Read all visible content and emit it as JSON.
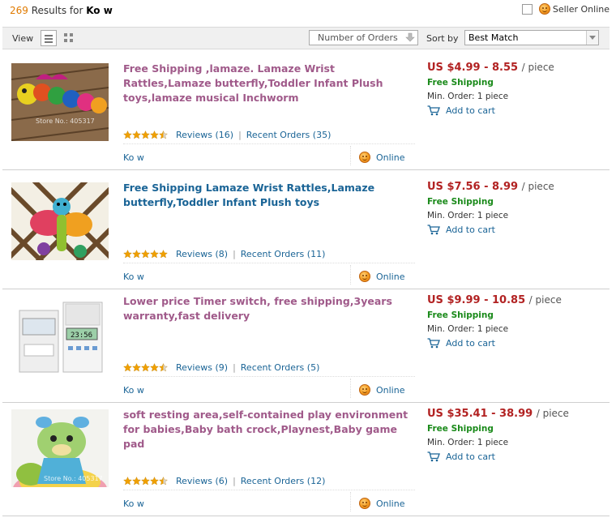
{
  "header": {
    "result_count": "269",
    "results_for": "Results for",
    "keyword": "Ko w",
    "seller_online_label": "Seller Online"
  },
  "toolbar": {
    "view_label": "View",
    "orders_sort_label": "Number of Orders",
    "sort_by_label": "Sort by",
    "sort_by_value": "Best Match"
  },
  "products": [
    {
      "title": "Free Shipping ,lamaze. Lamaze Wrist Rattles,Lamaze butterfly,Toddler Infant Plush toys,lamaze musical Inchworm",
      "rating": 4.5,
      "reviews": "Reviews (16)",
      "recent_orders": "Recent Orders (35)",
      "seller": "Ko w",
      "online": "Online",
      "price": "US $4.99 - 8.55",
      "unit": "/ piece",
      "shipping": "Free Shipping",
      "min_order": "Min. Order: 1 piece",
      "add_to_cart": "Add to cart",
      "image_watermark": "Store No.: 405317"
    },
    {
      "title": "Free Shipping Lamaze Wrist Rattles,Lamaze butterfly,Toddler Infant Plush toys",
      "rating": 5,
      "reviews": "Reviews (8)",
      "recent_orders": "Recent Orders (11)",
      "seller": "Ko w",
      "online": "Online",
      "price": "US $7.56 - 8.99",
      "unit": "/ piece",
      "shipping": "Free Shipping",
      "min_order": "Min. Order: 1 piece",
      "add_to_cart": "Add to cart",
      "image_watermark": ""
    },
    {
      "title": "Lower price Timer switch, free shipping,3years warranty,fast delivery",
      "rating": 4.5,
      "reviews": "Reviews (9)",
      "recent_orders": "Recent Orders (5)",
      "seller": "Ko w",
      "online": "Online",
      "price": "US $9.99 - 10.85",
      "unit": "/ piece",
      "shipping": "Free Shipping",
      "min_order": "Min. Order: 1 piece",
      "add_to_cart": "Add to cart",
      "image_watermark": ""
    },
    {
      "title": "soft resting area,self-contained play environment for babies,Baby bath crock,Playnest,Baby game pad",
      "rating": 4.5,
      "reviews": "Reviews (6)",
      "recent_orders": "Recent Orders (12)",
      "seller": "Ko w",
      "online": "Online",
      "price": "US $35.41 - 38.99",
      "unit": "/ piece",
      "shipping": "Free Shipping",
      "min_order": "Min. Order: 1 piece",
      "add_to_cart": "Add to cart",
      "image_watermark": "Store No.: 405317"
    }
  ],
  "colors": {
    "price": "#b22222",
    "free_shipping": "#1a8a1a",
    "link": "#1a6496",
    "title_purple": "#a05a8a",
    "count_orange": "#e07a00"
  }
}
